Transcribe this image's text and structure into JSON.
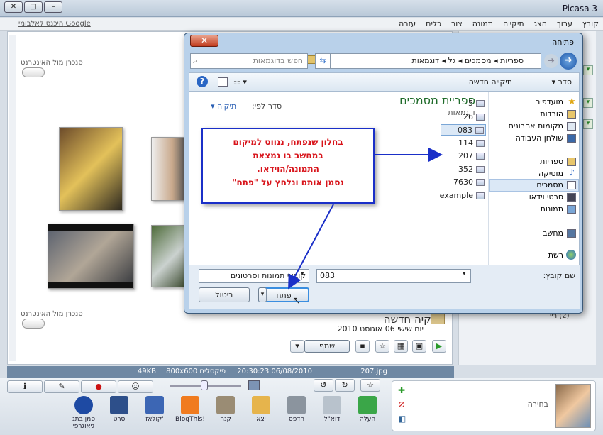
{
  "picasa": {
    "title": "Picasa 3",
    "menu": [
      "קובץ",
      "ערוך",
      "הצג",
      "תיקייה",
      "תמונה",
      "צור",
      "כלים",
      "עזרה"
    ],
    "google_signin": "היכנס לאלבומי Google",
    "sync_label": "סנכרן מול האינטרנט",
    "album_title": "תיקיה חדשה",
    "album_date": "יום שישי 06 אוגוסט 2010",
    "share_label": "שתף",
    "status": {
      "name": "207.jpg",
      "datetime": "20:30:23 06/08/2010",
      "dims": "800x600 פיקסלים",
      "size": "49KB"
    },
    "bottom_tools": [
      {
        "label": "העלה",
        "color": "#3aa648"
      },
      {
        "label": "דוא\"ל",
        "color": "#b8c2cc"
      },
      {
        "label": "הדפס",
        "color": "#8b949e"
      },
      {
        "label": "יצא",
        "color": "#e6b44c"
      },
      {
        "label": "קנה",
        "color": "#9a8c74"
      },
      {
        "label": "BlogThis!",
        "color": "#f07b1f"
      },
      {
        "label": "קולאז'",
        "color": "#3c66b4"
      },
      {
        "label": "סרט",
        "color": "#2d4f8a"
      },
      {
        "label": "סמן בתג גיאוגרפי",
        "color": "#1e4aa3"
      }
    ],
    "selection_label": "בחירה",
    "count_label": "(2) ריי"
  },
  "dialog": {
    "title": "פתיחה",
    "breadcrumb": [
      "ספריות",
      "מסמכים",
      "גל",
      "דוגמאות"
    ],
    "search_placeholder": "חפש בדוגמאות",
    "organize": "סדר",
    "new_folder": "תיקייה חדשה",
    "library_title": "ספריית מסמכים",
    "library_sub": "דוגמאות",
    "sort_by": "סדר לפי:",
    "sort_value": "תיקיה",
    "nav": {
      "favorites": "מועדפים",
      "downloads": "הורדות",
      "recent": "מקומות אחרונים",
      "desktop": "שולחן העבודה",
      "libraries": "ספריות",
      "music": "מוסיקה",
      "documents": "מסמכים",
      "videos": "סרטי וידאו",
      "pictures": "תמונות",
      "computer": "מחשב",
      "network": "רשת"
    },
    "files": [
      "5",
      "26",
      "083",
      "114",
      "207",
      "352",
      "7630",
      "example"
    ],
    "filename_label": "שם קובץ:",
    "filename_value": "083",
    "filetype": "קובצי תמונות וסרטונים",
    "open_btn": "פתח",
    "cancel_btn": "ביטול"
  },
  "callout": [
    "בחלון שנפתח, ננווט למיקום",
    "במחשב בו נמצאת",
    "התמונה/הוידאו.",
    "נסמן אותם ונלחץ על \"פתח\""
  ]
}
